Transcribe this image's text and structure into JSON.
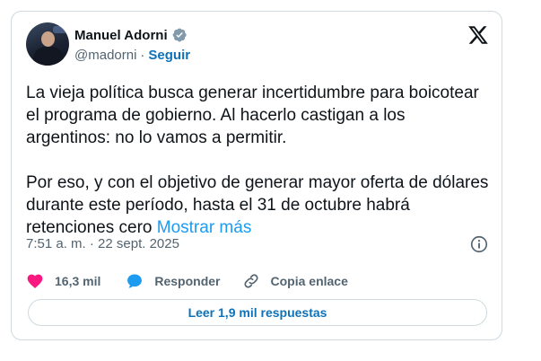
{
  "author": {
    "name": "Manuel Adorni",
    "handle": "@madorni",
    "separator": "·",
    "follow_label": "Seguir"
  },
  "tweet": {
    "paragraph1": "La vieja política busca generar incertidumbre para boicotear el programa de gobierno. Al hacerlo castigan a los argentinos: no lo vamos a permitir.",
    "paragraph2": "Por eso, y con el objetivo de generar mayor oferta de dólares durante este período, hasta el 31 de octubre habrá retenciones cero",
    "show_more": "Mostrar más",
    "timestamp": "7:51 a. m. · 22 sept. 2025"
  },
  "actions": {
    "likes": "16,3 mil",
    "reply_label": "Responder",
    "copy_link_label": "Copia enlace"
  },
  "read_replies_label": "Leer 1,9 mil respuestas",
  "icons": {
    "platform": "x-logo-icon",
    "verified": "verified-badge-icon",
    "info": "info-icon",
    "like": "heart-icon",
    "reply": "speech-bubble-icon",
    "copy": "link-icon"
  },
  "colors": {
    "accent": "#1d9bf0",
    "link": "#0f72b8",
    "like": "#f91880",
    "muted": "#536471"
  }
}
